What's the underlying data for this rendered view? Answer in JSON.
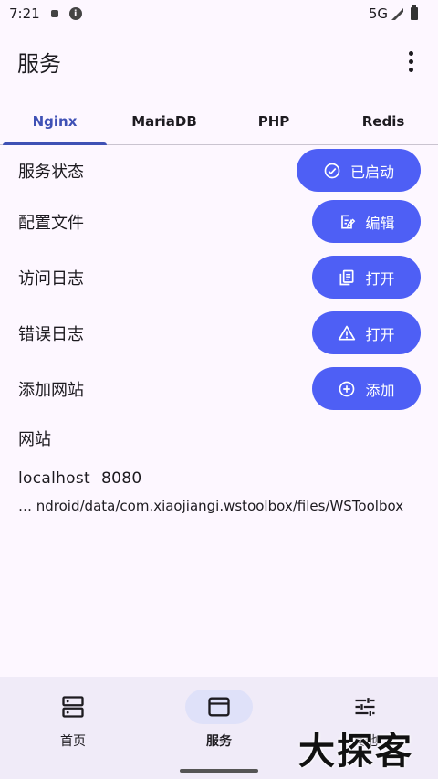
{
  "status_bar": {
    "time": "7:21",
    "network": "5G"
  },
  "app_bar": {
    "title": "服务"
  },
  "tabs": [
    {
      "label": "Nginx",
      "active": true
    },
    {
      "label": "MariaDB",
      "active": false
    },
    {
      "label": "PHP",
      "active": false
    },
    {
      "label": "Redis",
      "active": false
    }
  ],
  "rows": [
    {
      "label": "服务状态",
      "button": "已启动",
      "icon": "check-circle-icon"
    },
    {
      "label": "配置文件",
      "button": "编辑",
      "icon": "edit-doc-icon"
    },
    {
      "label": "访问日志",
      "button": "打开",
      "icon": "copy-doc-icon"
    },
    {
      "label": "错误日志",
      "button": "打开",
      "icon": "warning-icon"
    },
    {
      "label": "添加网站",
      "button": "添加",
      "icon": "add-circle-icon"
    }
  ],
  "sites": {
    "label": "网站",
    "items": [
      {
        "host": "localhost",
        "port": "8080",
        "path": "… ndroid/data/com.xiaojiangi.wstoolbox/files/WSToolbox"
      }
    ]
  },
  "bottom_nav": [
    {
      "label": "首页",
      "icon": "server-icon",
      "active": false
    },
    {
      "label": "服务",
      "icon": "window-icon",
      "active": true
    },
    {
      "label": "其他",
      "icon": "tune-icon",
      "active": false
    }
  ],
  "watermark": "大探客",
  "colors": {
    "accent": "#4e5ff5",
    "tab_active": "#3f51b5",
    "background": "#fdf7ff",
    "nav_background": "#f0ebf8"
  }
}
